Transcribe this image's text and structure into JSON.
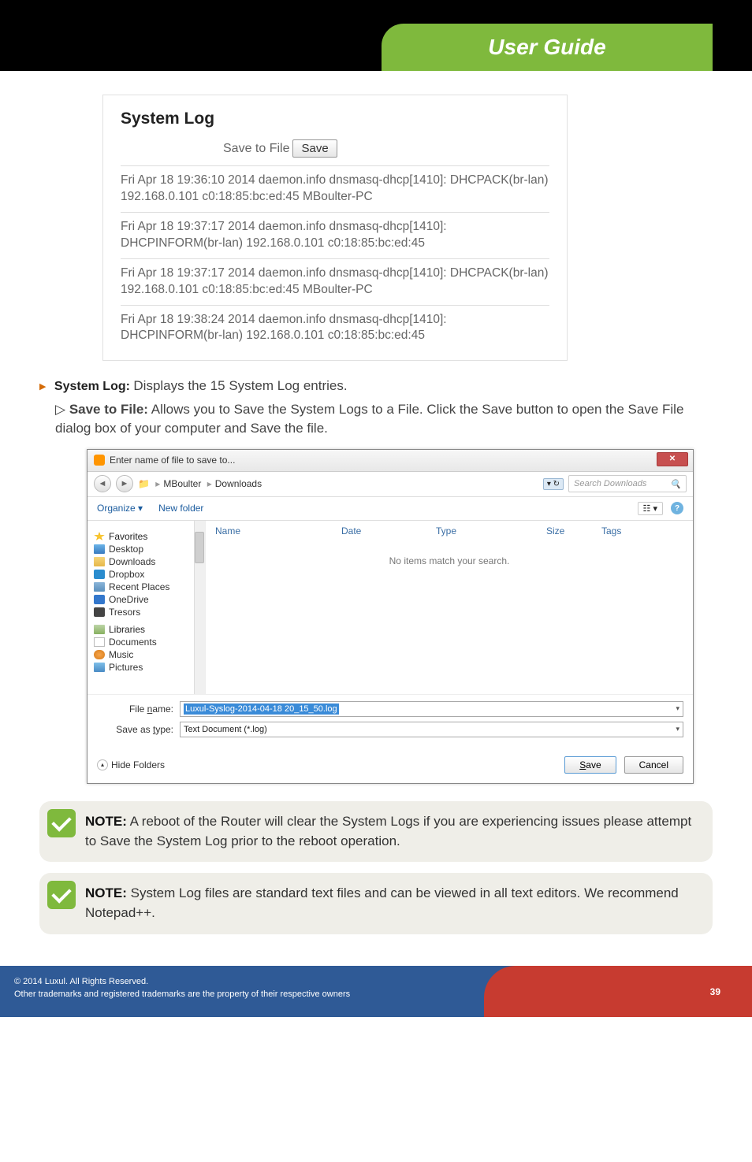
{
  "header": {
    "title": "User Guide"
  },
  "syslog": {
    "heading": "System Log",
    "save_label": "Save to File",
    "save_button": "Save",
    "entries": [
      "Fri Apr 18 19:36:10 2014 daemon.info dnsmasq-dhcp[1410]: DHCPACK(br-lan) 192.168.0.101 c0:18:85:bc:ed:45 MBoulter-PC",
      "Fri Apr 18 19:37:17 2014 daemon.info dnsmasq-dhcp[1410]: DHCPINFORM(br-lan) 192.168.0.101 c0:18:85:bc:ed:45",
      "Fri Apr 18 19:37:17 2014 daemon.info dnsmasq-dhcp[1410]: DHCPACK(br-lan) 192.168.0.101 c0:18:85:bc:ed:45 MBoulter-PC",
      "Fri Apr 18 19:38:24 2014 daemon.info dnsmasq-dhcp[1410]: DHCPINFORM(br-lan) 192.168.0.101 c0:18:85:bc:ed:45"
    ]
  },
  "body": {
    "item1_label": "System Log:",
    "item1_desc": " Displays the 15 System Log entries.",
    "item2_label": "Save to File:",
    "item2_desc": " Allows you to Save the System Logs to a File. Click the Save button to open the Save File dialog box of your computer and Save the file."
  },
  "dialog": {
    "title": "Enter name of file to save to...",
    "crumb1": "MBoulter",
    "crumb2": "Downloads",
    "search_placeholder": "Search Downloads",
    "organize": "Organize ▾",
    "newfolder": "New folder",
    "view": "☷ ▾",
    "cols": {
      "name": "Name",
      "date": "Date",
      "type": "Type",
      "size": "Size",
      "tags": "Tags"
    },
    "empty": "No items match your search.",
    "tree": {
      "favorites": "Favorites",
      "desktop": "Desktop",
      "downloads": "Downloads",
      "dropbox": "Dropbox",
      "recent": "Recent Places",
      "onedrive": "OneDrive",
      "tresors": "Tresors",
      "libraries": "Libraries",
      "documents": "Documents",
      "music": "Music",
      "pictures": "Pictures"
    },
    "filename_label": "File name:",
    "filename_value": "Luxul-Syslog-2014-04-18 20_15_50.log",
    "saveas_label": "Save as type:",
    "saveas_value": "Text Document (*.log)",
    "hide": "Hide Folders",
    "save": "Save",
    "cancel": "Cancel"
  },
  "note1_label": "NOTE:",
  "note1": " A reboot of the Router will clear the System Logs if you are experiencing issues please attempt to Save the System Log prior to the reboot operation.",
  "note2_label": "NOTE:",
  "note2": " System Log files are standard text files and can be viewed in all text editors. We recommend Notepad++.",
  "footer": {
    "copy": "© 2014  Luxul. All Rights Reserved.",
    "tm": "Other trademarks and registered trademarks are the property of their respective owners",
    "page": "39"
  }
}
